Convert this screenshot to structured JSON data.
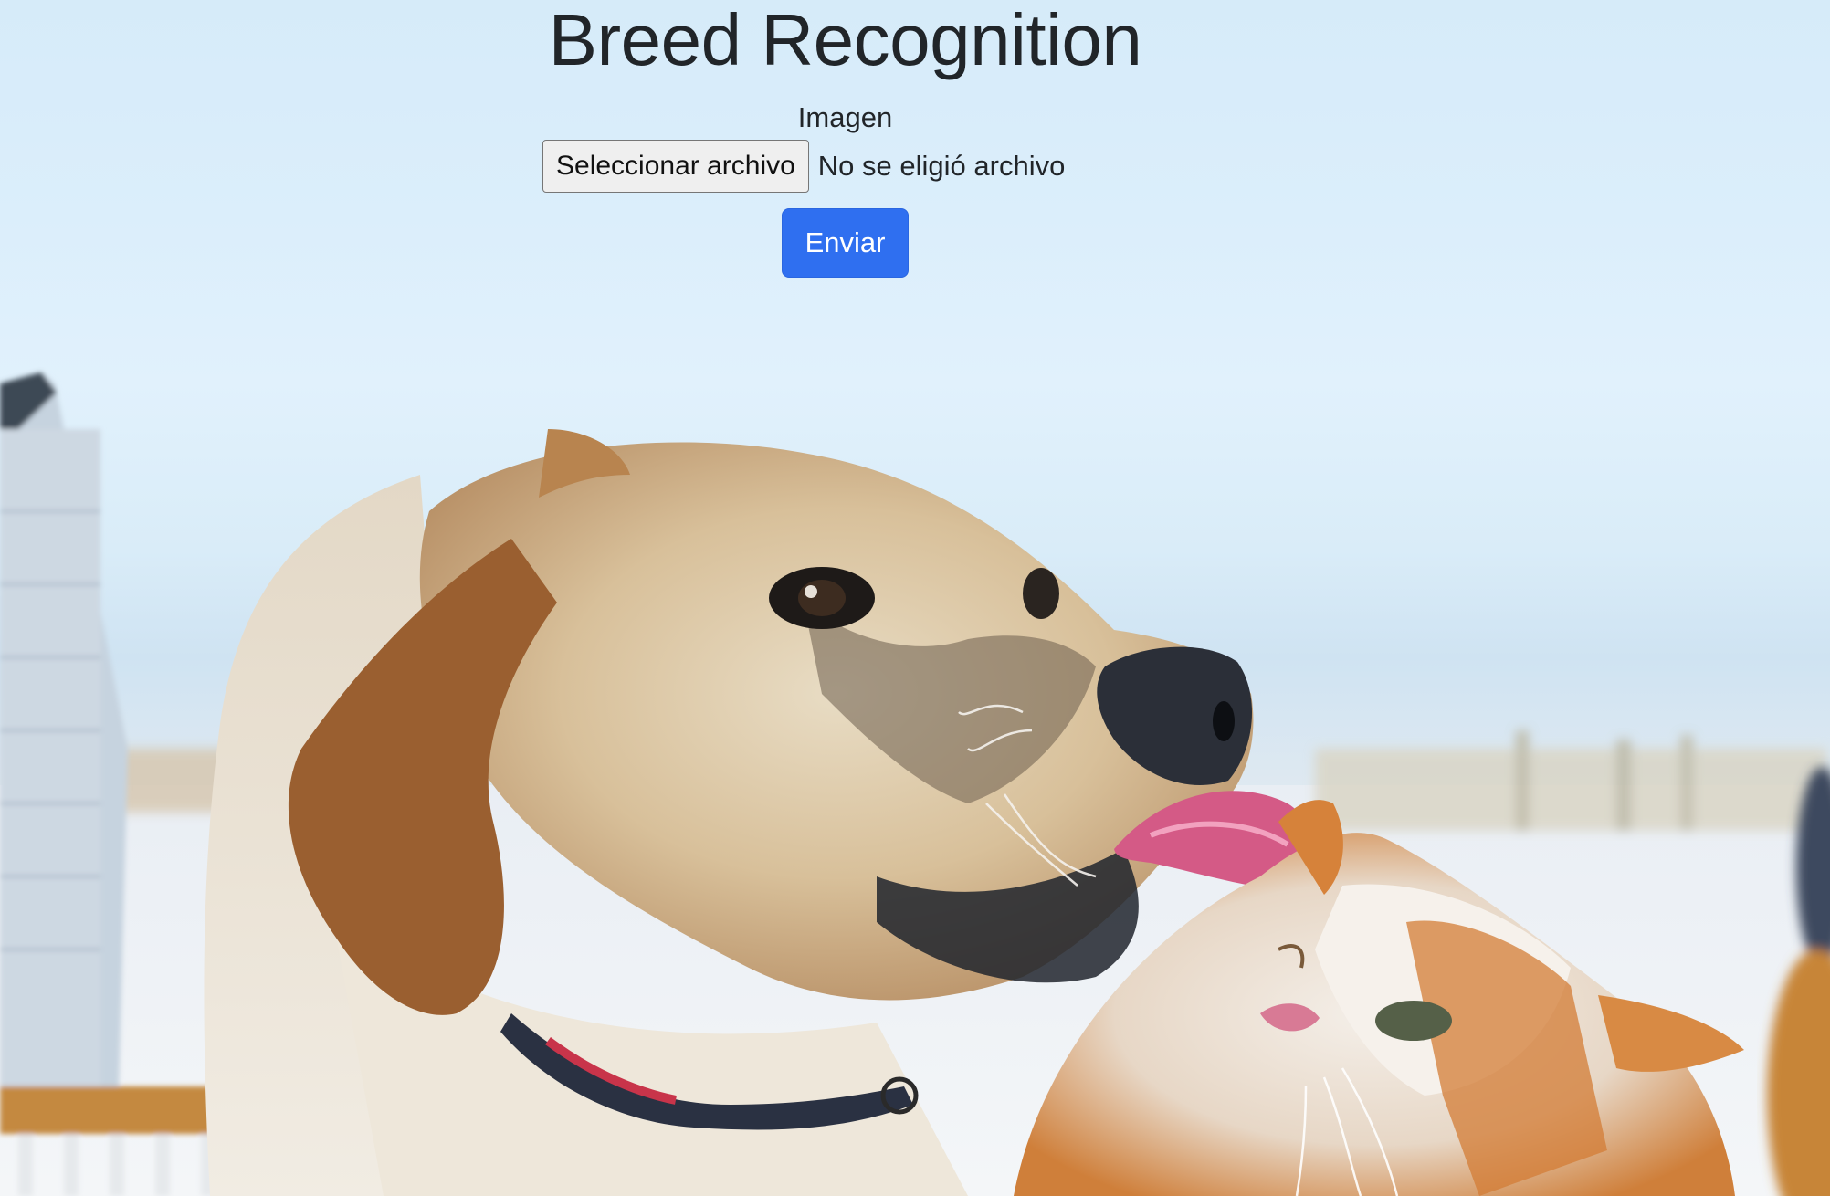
{
  "page": {
    "title": "Breed Recognition"
  },
  "form": {
    "image_label": "Imagen",
    "file_button_label": "Seleccionar archivo",
    "file_status": "No se eligió archivo",
    "submit_label": "Enviar"
  },
  "background": {
    "description_icon": "dog-and-cat-photo",
    "accent": "#2f6ff0"
  }
}
